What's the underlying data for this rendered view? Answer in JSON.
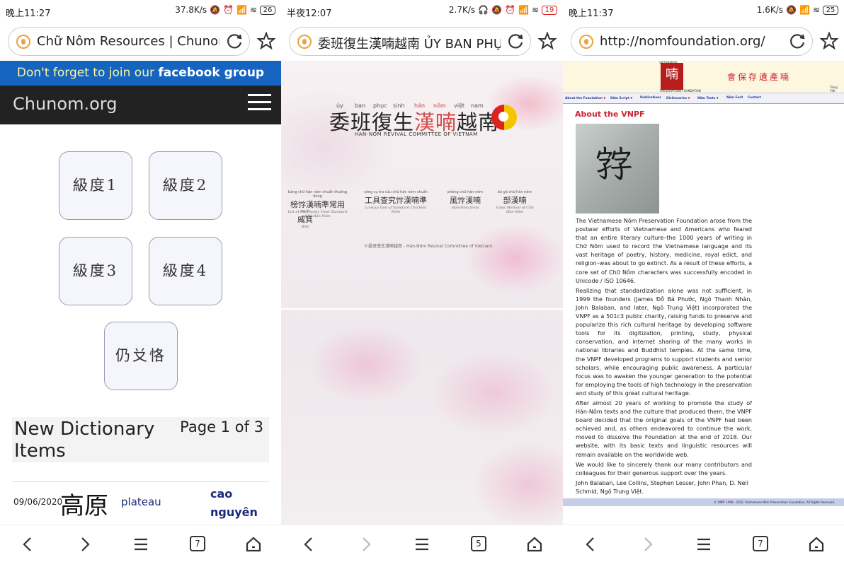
{
  "phone1": {
    "status": {
      "time": "晚上11:27",
      "speed": "37.8K/s",
      "battery": "26"
    },
    "url": "Chữ Nôm Resources | Chunom R",
    "banner": {
      "prefix": "Don't forget to join our ",
      "link": "facebook group"
    },
    "logo": "Chunom.org",
    "levels": [
      "級度1",
      "級度2",
      "級度3",
      "級度4",
      "仍𠬠恪"
    ],
    "new_items": {
      "title": "New Dictionary Items",
      "page": "Page 1 of 3"
    },
    "entry": {
      "date": "09/06/2020",
      "han": "高原",
      "meaning": "plateau",
      "quoc_ngu": "cao nguyên"
    },
    "tabs": "7"
  },
  "phone2": {
    "status": {
      "time": "半夜12:07",
      "speed": "2.7K/s",
      "battery": "19"
    },
    "url": "委班復生漢喃越南 ỦY BAN PHỤC",
    "ruby": [
      "ủy",
      "ban",
      "phục",
      "sinh",
      "hán",
      "nôm",
      "việt",
      "nam"
    ],
    "title_pre": "委班復生",
    "title_red": "漢喃",
    "title_post": "越南",
    "subtitle": "HAN-NOM REVIVAL COMMITTEE OF VIETNAM",
    "links": [
      {
        "ruby": "bảng chữ hán nôm chuẩn thường dùng",
        "han": "榜𡨸漢喃準常用",
        "en": "List of Commonly Used Standard Chữ Hán Nôm"
      },
      {
        "ruby": "công cụ tra cứu chữ hán nôm chuẩn",
        "han": "工具查究𡨸漢喃準",
        "en": "Lookup Tool of Standard Chữ Hán Nôm"
      },
      {
        "ruby": "phông chữ hán nôm",
        "han": "風𡨸漢喃",
        "en": "Hán-Nôm fonts"
      },
      {
        "ruby": "bộ gõ chữ hán nôm",
        "han": "部𡓁𡨸漢喃",
        "en": "Input Method of Chữ Hán Nôm"
      },
      {
        "ruby": "uy ki",
        "han": "威箕",
        "en": "Wiki"
      }
    ],
    "footer": "©委班復生漢喃越南 - Hán-Nôm Revival Committee of Vietnam",
    "tabs": "5"
  },
  "phone3": {
    "status": {
      "time": "晚上11:37",
      "speed": "1.6K/s",
      "battery": "25"
    },
    "url": "http://nomfoundation.org/",
    "logo_top": "VIETNAMESE",
    "logo_char": "喃",
    "logo_bottom": "PRESERVATION FOUNDATION",
    "slogan": "會保存遺產喃",
    "lang": "Tiếng Việt",
    "nav": [
      "About the Foundation",
      "Nôm Script",
      "Publications",
      "Dictionaries",
      "Nôm Texts",
      "Nôm Font",
      "Contact"
    ],
    "heading": "About the VNPF",
    "image_char": "𡦂",
    "paragraphs": [
      "The Vietnamese Nôm Preservation Foundation arose from the postwar efforts of Vietnamese and Americans who feared that an entire literary culture–the 1000 years of writing in Chữ Nôm used to record the Vietnamese language and its vast heritage of poetry, history, medicine, royal edict, and religion–was about to go extinct. As a result of these efforts, a core set of Chữ Nôm characters was successfully encoded in Unicode / ISO 10646.",
      "Realizing that standardization alone was not sufficient, in 1999 the founders (James Đỗ Bá Phước, Ngô Thanh Nhàn, John Balaban, and later, Ngô Trung Việt) incorporated the VNPF as a 501c3 public charity, raising funds to preserve and popularize this rich cultural heritage by developing software tools for its digitization, printing, study, physical conservation, and internet sharing of the many works in national libraries and Buddhist temples. At the same time, the VNPF developed programs to support students and senior scholars, while encouraging public awareness. A particular focus was to awaken the younger generation to the potential for employing the tools of high technology in the preservation and study of this great cultural heritage.",
      "After almost 20 years of working to promote the study of Hán-Nôm texts and the culture that produced them, the VNPF board decided that the original goals of the VNPF had been achieved and, as others endeavored to continue the work, moved to dissolve the Foundation at the end of 2018. Our website, with its basic texts and linguistic resources will remain available on the worldwide web.",
      "We would like to sincerely thank our many contributors and colleagues for their generous support over the years.",
      "John Balaban, Lee Collins, Stephen Lesser, John Phan, D. Neil Schmid, Ngô Trung Việt."
    ],
    "footer": "© VNPF 1999 - 2022. Vietnamese Nôm Preservation Foundation, All Rights Reserved.",
    "tabs": "7"
  }
}
